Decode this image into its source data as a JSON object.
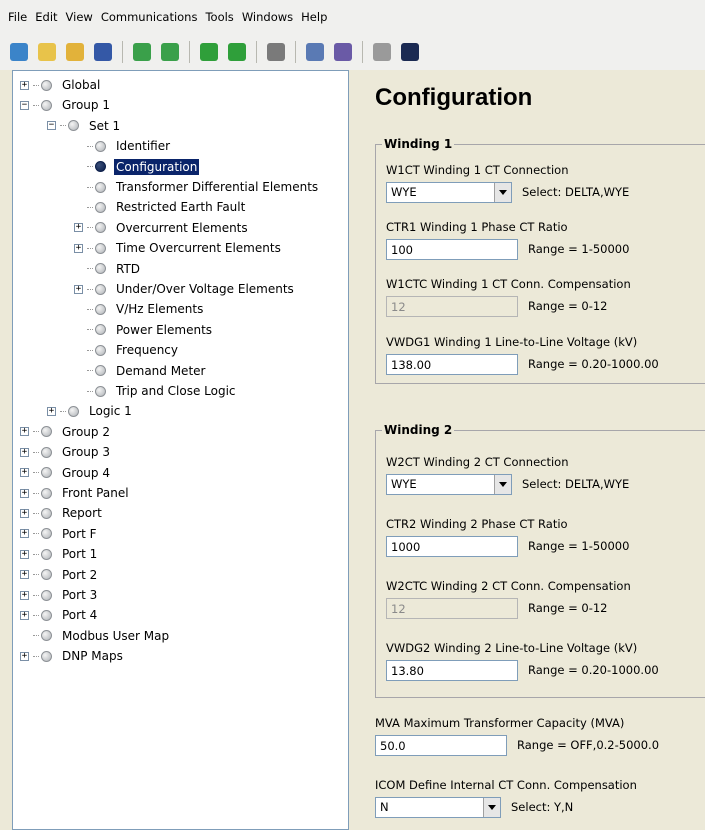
{
  "menu": [
    "File",
    "Edit",
    "View",
    "Communications",
    "Tools",
    "Windows",
    "Help"
  ],
  "toolbar": [
    {
      "icon": "home-icon",
      "color": "#3b84c9"
    },
    {
      "icon": "new-file-icon",
      "color": "#e8c34a"
    },
    {
      "icon": "open-folder-icon",
      "color": "#e2b23a"
    },
    {
      "icon": "save-icon",
      "color": "#3458a6"
    },
    {
      "sep": true
    },
    {
      "icon": "import-icon",
      "color": "#3aa04a"
    },
    {
      "icon": "export-icon",
      "color": "#3aa04a"
    },
    {
      "sep": true
    },
    {
      "icon": "download-icon",
      "color": "#2f9f3a"
    },
    {
      "icon": "upload-icon",
      "color": "#2f9f3a"
    },
    {
      "sep": true
    },
    {
      "icon": "spell-check-icon",
      "color": "#7a7a7a"
    },
    {
      "sep": true
    },
    {
      "icon": "compare-icon",
      "color": "#5a7ab4"
    },
    {
      "icon": "report-icon",
      "color": "#6a5aa6"
    },
    {
      "sep": true
    },
    {
      "icon": "meter-icon",
      "color": "#9a9a9a"
    },
    {
      "icon": "terminal-icon",
      "color": "#1b2a52"
    }
  ],
  "tree": [
    {
      "label": "Global",
      "level": 0,
      "toggle": "+"
    },
    {
      "label": "Group 1",
      "level": 0,
      "toggle": "-"
    },
    {
      "label": "Set 1",
      "level": 1,
      "toggle": "-"
    },
    {
      "label": "Identifier",
      "level": 2,
      "toggle": ""
    },
    {
      "label": "Configuration",
      "level": 2,
      "toggle": "",
      "selected": true
    },
    {
      "label": "Transformer Differential Elements",
      "level": 2,
      "toggle": ""
    },
    {
      "label": "Restricted Earth Fault",
      "level": 2,
      "toggle": ""
    },
    {
      "label": "Overcurrent Elements",
      "level": 2,
      "toggle": "+"
    },
    {
      "label": "Time Overcurrent Elements",
      "level": 2,
      "toggle": "+"
    },
    {
      "label": "RTD",
      "level": 2,
      "toggle": ""
    },
    {
      "label": "Under/Over Voltage Elements",
      "level": 2,
      "toggle": "+"
    },
    {
      "label": "V/Hz Elements",
      "level": 2,
      "toggle": ""
    },
    {
      "label": "Power Elements",
      "level": 2,
      "toggle": ""
    },
    {
      "label": "Frequency",
      "level": 2,
      "toggle": ""
    },
    {
      "label": "Demand Meter",
      "level": 2,
      "toggle": ""
    },
    {
      "label": "Trip and Close  Logic",
      "level": 2,
      "toggle": ""
    },
    {
      "label": "Logic 1",
      "level": 1,
      "toggle": "+"
    },
    {
      "label": "Group 2",
      "level": 0,
      "toggle": "+"
    },
    {
      "label": "Group 3",
      "level": 0,
      "toggle": "+"
    },
    {
      "label": "Group 4",
      "level": 0,
      "toggle": "+"
    },
    {
      "label": "Front Panel",
      "level": 0,
      "toggle": "+"
    },
    {
      "label": "Report",
      "level": 0,
      "toggle": "+"
    },
    {
      "label": "Port F",
      "level": 0,
      "toggle": "+"
    },
    {
      "label": "Port 1",
      "level": 0,
      "toggle": "+"
    },
    {
      "label": "Port 2",
      "level": 0,
      "toggle": "+"
    },
    {
      "label": "Port 3",
      "level": 0,
      "toggle": "+"
    },
    {
      "label": "Port 4",
      "level": 0,
      "toggle": "+"
    },
    {
      "label": "Modbus User Map",
      "level": 0,
      "toggle": ""
    },
    {
      "label": "DNP Maps",
      "level": 0,
      "toggle": "+"
    }
  ],
  "panel": {
    "title": "Configuration",
    "winding1": {
      "title": "Winding 1",
      "w1ct": {
        "label": "W1CT  Winding 1 CT Connection",
        "value": "WYE",
        "hint": "Select: DELTA,WYE"
      },
      "ctr1": {
        "label": "CTR1  Winding 1 Phase CT Ratio",
        "value": "100",
        "hint": "Range = 1-50000"
      },
      "w1ctc": {
        "label": "W1CTC  Winding 1 CT Conn. Compensation",
        "value": "12",
        "hint": "Range = 0-12"
      },
      "vwdg1": {
        "label": "VWDG1  Winding 1 Line-to-Line Voltage (kV)",
        "value": "138.00",
        "hint": "Range = 0.20-1000.00"
      }
    },
    "winding2": {
      "title": "Winding 2",
      "w2ct": {
        "label": "W2CT  Winding 2 CT Connection",
        "value": "WYE",
        "hint": "Select: DELTA,WYE"
      },
      "ctr2": {
        "label": "CTR2  Winding 2 Phase CT Ratio",
        "value": "1000",
        "hint": "Range = 1-50000"
      },
      "w2ctc": {
        "label": "W2CTC  Winding 2 CT Conn. Compensation",
        "value": "12",
        "hint": "Range = 0-12"
      },
      "vwdg2": {
        "label": "VWDG2  Winding 2 Line-to-Line Voltage (kV)",
        "value": "13.80",
        "hint": "Range = 0.20-1000.00"
      }
    },
    "mva": {
      "label": "MVA  Maximum Transformer Capacity (MVA)",
      "value": "50.0",
      "hint": "Range = OFF,0.2-5000.0"
    },
    "icom": {
      "label": "ICOM  Define Internal CT Conn. Compensation",
      "value": "N",
      "hint": "Select: Y,N"
    }
  }
}
